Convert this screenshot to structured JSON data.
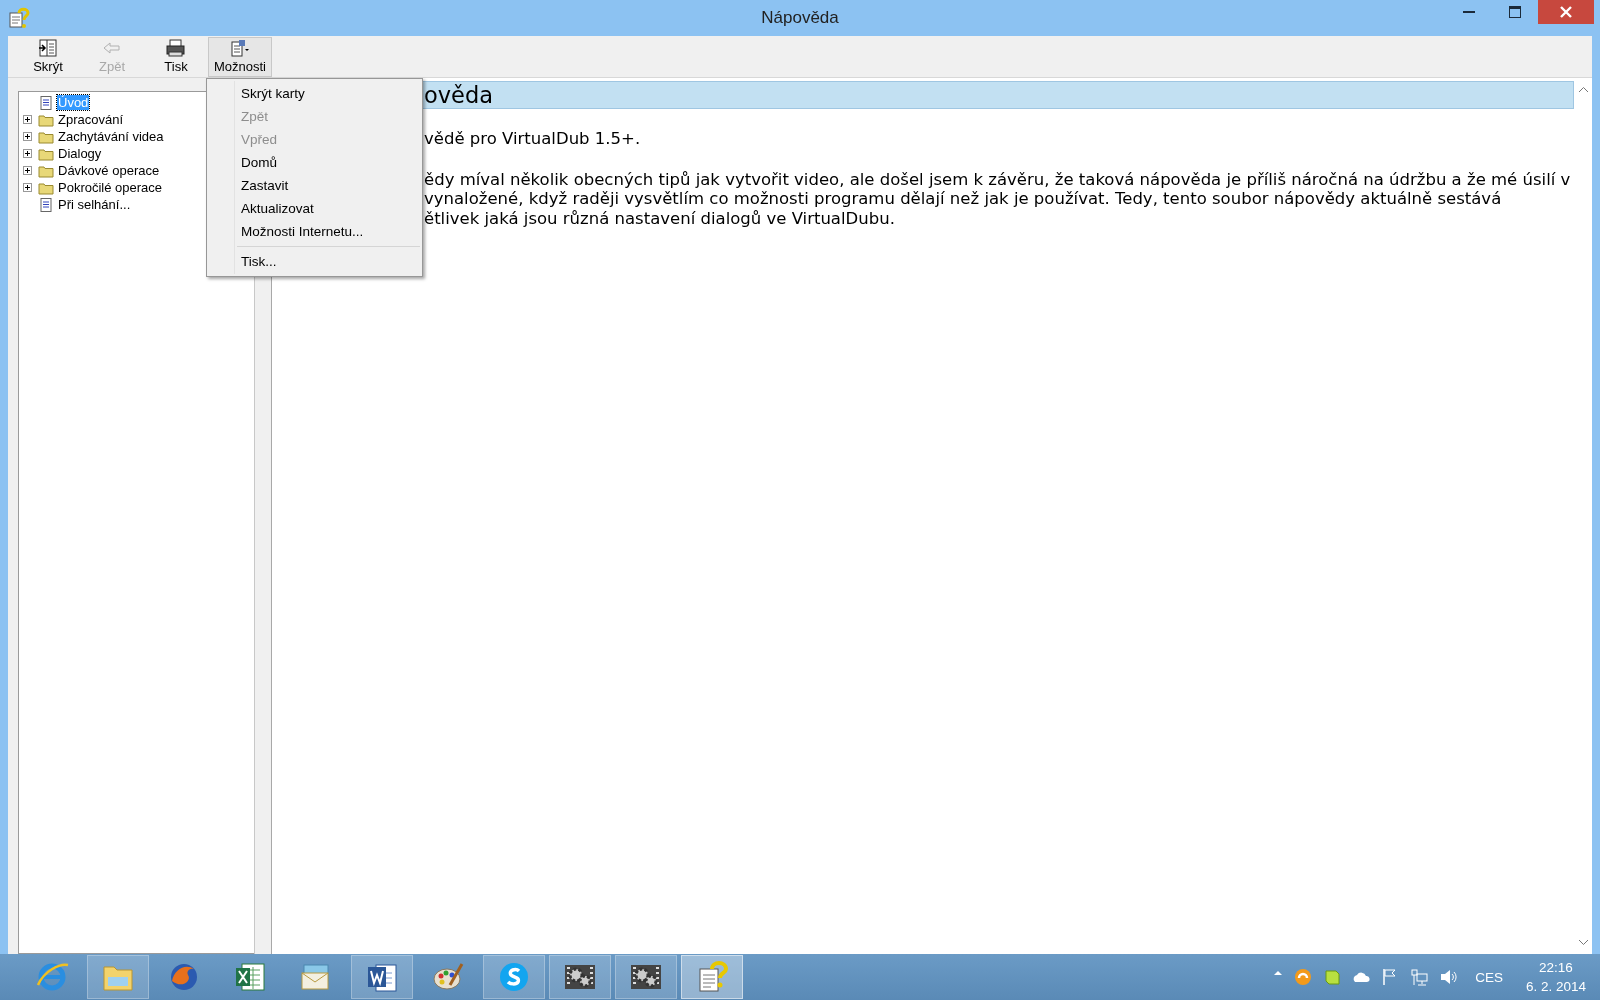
{
  "window": {
    "title": "Nápověda"
  },
  "toolbar": [
    {
      "label": "Skrýt",
      "kind": "hide",
      "disabled": false,
      "pressed": false
    },
    {
      "label": "Zpět",
      "kind": "back",
      "disabled": true,
      "pressed": false
    },
    {
      "label": "Tisk",
      "kind": "print",
      "disabled": false,
      "pressed": false
    },
    {
      "label": "Možnosti",
      "kind": "options",
      "disabled": false,
      "pressed": true
    }
  ],
  "tree": [
    {
      "label": "Úvod",
      "kind": "page",
      "selected": true
    },
    {
      "label": "Zpracování",
      "kind": "folder",
      "selected": false,
      "expanded": false
    },
    {
      "label": "Zachytávání videa",
      "kind": "folder",
      "selected": false,
      "expanded": false
    },
    {
      "label": "Dialogy",
      "kind": "folder",
      "selected": false,
      "expanded": false
    },
    {
      "label": "Dávkové operace",
      "kind": "folder",
      "selected": false,
      "expanded": false
    },
    {
      "label": "Pokročilé operace",
      "kind": "folder",
      "selected": false,
      "expanded": false
    },
    {
      "label": "Při selhání...",
      "kind": "page",
      "selected": false
    }
  ],
  "content": {
    "heading": "ověda",
    "intro": "vědě pro VirtualDub 1.5+.",
    "paragraph_lines": [
      "ědy míval několik obecných tipů jak vytvořit video, ale došel jsem k závěru, že taková nápověda je příliš náročná na údržbu a že mé úsilí v",
      "vynaložené, když raději vysvětlím co možnosti programu dělají než jak je používat. Tedy, tento soubor nápovědy aktuálně sestává",
      "ětlivek jaká jsou různá nastavení dialogů ve VirtualDubu."
    ]
  },
  "menu": [
    {
      "kind": "item",
      "label": "Skrýt karty",
      "disabled": false
    },
    {
      "kind": "item",
      "label": "Zpět",
      "disabled": true
    },
    {
      "kind": "item",
      "label": "Vpřed",
      "disabled": true
    },
    {
      "kind": "item",
      "label": "Domů",
      "disabled": false
    },
    {
      "kind": "item",
      "label": "Zastavit",
      "disabled": false
    },
    {
      "kind": "item",
      "label": "Aktualizovat",
      "disabled": false
    },
    {
      "kind": "item",
      "label": "Možnosti Internetu...",
      "disabled": false
    },
    {
      "kind": "separator"
    },
    {
      "kind": "item",
      "label": "Tisk...",
      "disabled": false
    }
  ],
  "taskbar": {
    "apps": [
      {
        "kind": "browser",
        "running": false,
        "selected": false
      },
      {
        "kind": "folder",
        "running": true,
        "selected": false
      },
      {
        "kind": "fox",
        "running": false,
        "selected": false
      },
      {
        "kind": "sheet",
        "running": false,
        "selected": false
      },
      {
        "kind": "mail",
        "running": false,
        "selected": false
      },
      {
        "kind": "doc",
        "running": true,
        "selected": false
      },
      {
        "kind": "palette",
        "running": false,
        "selected": false
      },
      {
        "kind": "chat",
        "running": true,
        "selected": false
      },
      {
        "kind": "film-gear",
        "running": true,
        "selected": false
      },
      {
        "kind": "film-gear",
        "running": true,
        "selected": false
      },
      {
        "kind": "help",
        "running": true,
        "selected": true
      }
    ],
    "language": "CES",
    "time": "22:16",
    "date": "6. 2. 2014"
  }
}
